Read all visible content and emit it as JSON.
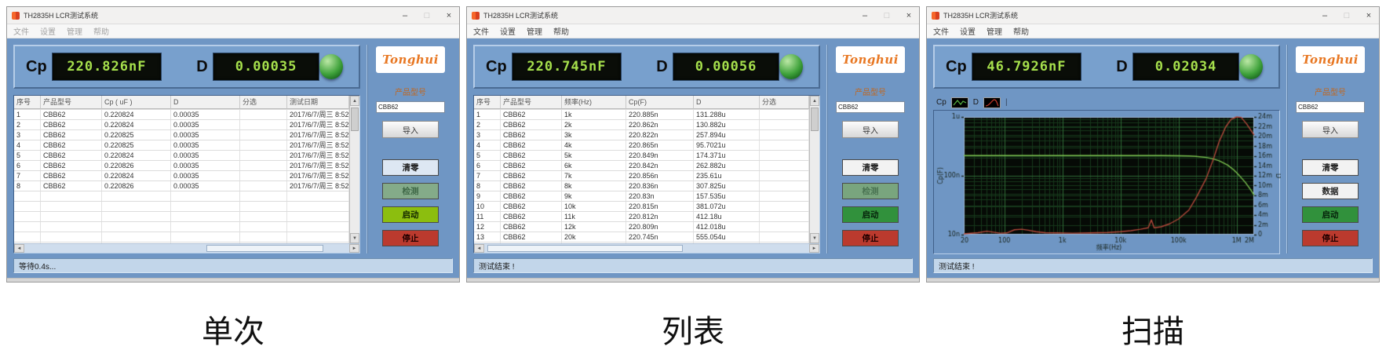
{
  "captions": [
    "单次",
    "列表",
    "扫描"
  ],
  "windows": [
    {
      "title": "TH2835H LCR测试系统",
      "controls": {
        "minimize": "–",
        "maximize": "□",
        "close": "×"
      },
      "menus": [
        "文件",
        "设置",
        "管理",
        "帮助"
      ],
      "display": {
        "cp_label": "Cp",
        "cp_value": "220.826nF",
        "d_label": "D",
        "d_value": "0.00035"
      },
      "sidebar": {
        "logo_text": "Tonghui",
        "product_label": "产品型号",
        "product_value": "CBB62",
        "import_label": "导入",
        "action_buttons": [
          {
            "label": "清零",
            "bg": "#dde7f3",
            "fg": "#222222"
          },
          {
            "label": "检测",
            "bg": "#84ab89",
            "fg": "#3f6847"
          },
          {
            "label": "启动",
            "bg": "#8cbe0f",
            "fg": "#142800"
          },
          {
            "label": "停止",
            "bg": "#bb3a2e",
            "fg": "#200000"
          }
        ]
      },
      "table": {
        "headers": [
          "序号",
          "产品型号",
          "Cp ( uF )",
          "D",
          "分选",
          "测试日期"
        ],
        "rows": [
          [
            "1",
            "CBB62",
            "0.220824",
            "0.00035",
            "",
            "2017/6/7/周三 8:52"
          ],
          [
            "2",
            "CBB62",
            "0.220824",
            "0.00035",
            "",
            "2017/6/7/周三 8:52"
          ],
          [
            "3",
            "CBB62",
            "0.220825",
            "0.00035",
            "",
            "2017/6/7/周三 8:52"
          ],
          [
            "4",
            "CBB62",
            "0.220825",
            "0.00035",
            "",
            "2017/6/7/周三 8:52"
          ],
          [
            "5",
            "CBB62",
            "0.220824",
            "0.00035",
            "",
            "2017/6/7/周三 8:52"
          ],
          [
            "6",
            "CBB62",
            "0.220826",
            "0.00035",
            "",
            "2017/6/7/周三 8:52"
          ],
          [
            "7",
            "CBB62",
            "0.220824",
            "0.00035",
            "",
            "2017/6/7/周三 8:52"
          ],
          [
            "8",
            "CBB62",
            "0.220826",
            "0.00035",
            "",
            "2017/6/7/周三 8:52"
          ]
        ],
        "empty_rows": 6
      },
      "status": "等待0.4s..."
    },
    {
      "title": "TH2835H LCR测试系统",
      "controls": {
        "minimize": "–",
        "maximize": "□",
        "close": "×"
      },
      "menus": [
        "文件",
        "设置",
        "管理",
        "帮助"
      ],
      "display": {
        "cp_label": "Cp",
        "cp_value": "220.745nF",
        "d_label": "D",
        "d_value": "0.00056"
      },
      "sidebar": {
        "logo_text": "Tonghui",
        "product_label": "产品型号",
        "product_value": "CBB62",
        "import_label": "导入",
        "action_buttons": [
          {
            "label": "清零",
            "bg": "#f2f2f2",
            "fg": "#222222"
          },
          {
            "label": "检测",
            "bg": "#79a57e",
            "fg": "#4a7352"
          },
          {
            "label": "启动",
            "bg": "#31913c",
            "fg": "#06230b"
          },
          {
            "label": "停止",
            "bg": "#bb3a2e",
            "fg": "#200000"
          }
        ]
      },
      "table": {
        "headers": [
          "序号",
          "产品型号",
          "频率(Hz)",
          "Cp(F)",
          "D",
          "分选"
        ],
        "rows": [
          [
            "1",
            "CBB62",
            "1k",
            "220.885n",
            "131.288u",
            ""
          ],
          [
            "2",
            "CBB62",
            "2k",
            "220.862n",
            "130.882u",
            ""
          ],
          [
            "3",
            "CBB62",
            "3k",
            "220.822n",
            "257.894u",
            ""
          ],
          [
            "4",
            "CBB62",
            "4k",
            "220.865n",
            "95.7021u",
            ""
          ],
          [
            "5",
            "CBB62",
            "5k",
            "220.849n",
            "174.371u",
            ""
          ],
          [
            "6",
            "CBB62",
            "6k",
            "220.842n",
            "262.882u",
            ""
          ],
          [
            "7",
            "CBB62",
            "7k",
            "220.856n",
            "235.61u",
            ""
          ],
          [
            "8",
            "CBB62",
            "8k",
            "220.836n",
            "307.825u",
            ""
          ],
          [
            "9",
            "CBB62",
            "9k",
            "220.83n",
            "157.535u",
            ""
          ],
          [
            "10",
            "CBB62",
            "10k",
            "220.815n",
            "381.072u",
            ""
          ],
          [
            "11",
            "CBB62",
            "11k",
            "220.812n",
            "412.18u",
            ""
          ],
          [
            "12",
            "CBB62",
            "12k",
            "220.809n",
            "412.018u",
            ""
          ],
          [
            "13",
            "CBB62",
            "20k",
            "220.745n",
            "555.054u",
            ""
          ]
        ],
        "empty_rows": 2
      },
      "status": "测试结束 !"
    },
    {
      "title": "TH2835H LCR测试系统",
      "controls": {
        "minimize": "–",
        "maximize": "□",
        "close": "×"
      },
      "menus": [
        "文件",
        "设置",
        "管理",
        "帮助"
      ],
      "display": {
        "cp_label": "Cp",
        "cp_value": "46.7926nF",
        "d_label": "D",
        "d_value": "0.02034"
      },
      "sidebar": {
        "logo_text": "Tonghui",
        "product_label": "产品型号",
        "product_value": "CBB62",
        "import_label": "导入",
        "action_buttons": [
          {
            "label": "清零",
            "bg": "#f2f2f2",
            "fg": "#222222"
          },
          {
            "label": "数据",
            "bg": "#f2f2f2",
            "fg": "#222222"
          },
          {
            "label": "启动",
            "bg": "#31913c",
            "fg": "#06230b"
          },
          {
            "label": "停止",
            "bg": "#bb3a2e",
            "fg": "#200000"
          }
        ]
      },
      "chart_tabs": [
        {
          "label": "Cp"
        },
        {
          "label": "D"
        }
      ],
      "chart_data": {
        "type": "line",
        "x_axis": {
          "label": "频率(Hz)",
          "scale": "log",
          "min": 20,
          "max": 2000000,
          "ticks": [
            "20",
            "100",
            "1k",
            "10k",
            "100k",
            "1M",
            "2M"
          ],
          "tick_values": [
            20,
            100,
            1000,
            10000,
            100000,
            1000000,
            2000000
          ]
        },
        "y_left": {
          "label": "Cp(F)",
          "scale": "log",
          "min": 1e-08,
          "max": 1e-06,
          "ticks": [
            "1u",
            "100n",
            "10n"
          ],
          "tick_values": [
            1e-06,
            1e-07,
            1e-08
          ]
        },
        "y_right": {
          "label": "D",
          "scale": "linear",
          "min": 0,
          "max": 0.024,
          "tick_step": 0.002,
          "ticks": [
            "24m",
            "22m",
            "20m",
            "18m",
            "16m",
            "14m",
            "12m",
            "10m",
            "8m",
            "6m",
            "4m",
            "2m",
            "0"
          ]
        },
        "grid": true,
        "plot_bg": "#060a06",
        "series": [
          {
            "name": "Cp",
            "axis": "left",
            "color": "#7cc24f",
            "points": [
              [
                20,
                2.208e-07
              ],
              [
                100,
                2.208e-07
              ],
              [
                1000,
                2.207e-07
              ],
              [
                10000,
                2.205e-07
              ],
              [
                50000,
                2.2e-07
              ],
              [
                100000,
                2.19e-07
              ],
              [
                150000,
                2.17e-07
              ],
              [
                200000,
                2.14e-07
              ],
              [
                300000,
                2.05e-07
              ],
              [
                400000,
                1.93e-07
              ],
              [
                500000,
                1.8e-07
              ],
              [
                700000,
                1.52e-07
              ],
              [
                900000,
                1.25e-07
              ],
              [
                1100000,
                1.02e-07
              ],
              [
                1400000,
                7.8e-08
              ],
              [
                1700000,
                6e-08
              ],
              [
                2000000,
                4.68e-08
              ]
            ]
          },
          {
            "name": "D",
            "axis": "right",
            "color": "#b5493b",
            "points": [
              [
                20,
                0.00015
              ],
              [
                35,
                0.0004
              ],
              [
                50,
                0.0007
              ],
              [
                65,
                0.0005
              ],
              [
                85,
                0.0003
              ],
              [
                110,
                0.00035
              ],
              [
                150,
                0.001
              ],
              [
                200,
                0.0011
              ],
              [
                260,
                0.0009
              ],
              [
                350,
                0.0006
              ],
              [
                500,
                0.0004
              ],
              [
                800,
                0.00035
              ],
              [
                1500,
                0.0003
              ],
              [
                3000,
                0.00035
              ],
              [
                6000,
                0.00045
              ],
              [
                10000,
                0.0006
              ],
              [
                15000,
                0.0008
              ],
              [
                22000,
                0.0011
              ],
              [
                30000,
                0.0014
              ],
              [
                34000,
                0.003
              ],
              [
                38000,
                0.0014
              ],
              [
                50000,
                0.0016
              ],
              [
                70000,
                0.0022
              ],
              [
                100000,
                0.0032
              ],
              [
                150000,
                0.005
              ],
              [
                200000,
                0.0075
              ],
              [
                300000,
                0.0115
              ],
              [
                400000,
                0.0155
              ],
              [
                500000,
                0.019
              ],
              [
                650000,
                0.022
              ],
              [
                800000,
                0.0235
              ],
              [
                1000000,
                0.024
              ],
              [
                1200000,
                0.0239
              ],
              [
                1500000,
                0.0225
              ],
              [
                2000000,
                0.0203
              ]
            ]
          }
        ]
      },
      "status": "测试结束 !"
    }
  ]
}
